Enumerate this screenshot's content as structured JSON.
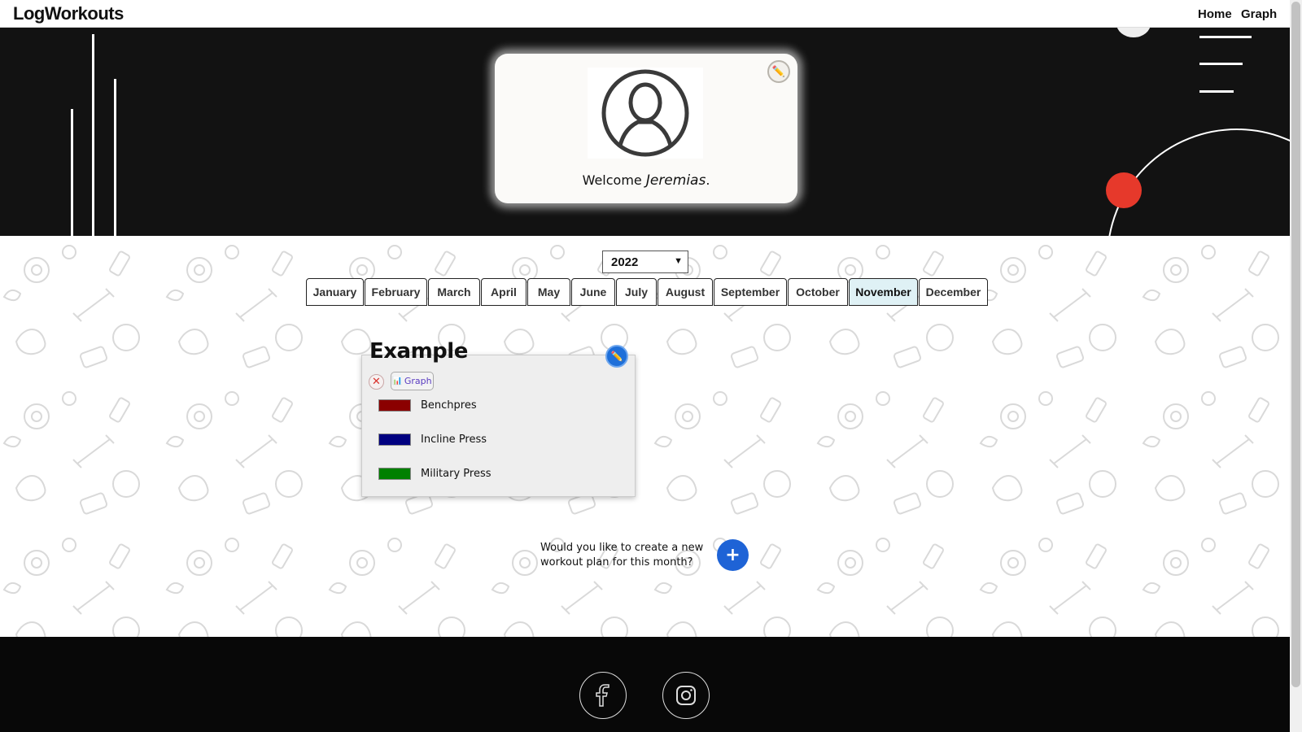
{
  "navbar": {
    "brand": "LogWorkouts",
    "links": [
      "Home",
      "Graph"
    ]
  },
  "profile": {
    "welcome_text": "Welcome",
    "username": "Jeremias",
    "username_suffix": ".",
    "avatar_icon": "user-silhouette-icon",
    "edit_icon": "pencil-icon"
  },
  "calendar": {
    "selected_year": "2022",
    "months": [
      "January",
      "February",
      "March",
      "April",
      "May",
      "June",
      "July",
      "August",
      "September",
      "October",
      "November",
      "December"
    ],
    "active_month": "November"
  },
  "plan": {
    "title": "Example",
    "graph_button_label": "Graph",
    "exercises": [
      {
        "name": "Benchpres",
        "color": "#8b0000"
      },
      {
        "name": "Incline Press",
        "color": "#000080"
      },
      {
        "name": "Military Press",
        "color": "#008000"
      }
    ]
  },
  "create_plan": {
    "prompt": "Would you like to create a new workout plan for this month?",
    "button_label": "+"
  },
  "footer": {
    "social": [
      "facebook-icon",
      "instagram-icon"
    ]
  },
  "colors": {
    "hero_bg": "#121212",
    "accent_red": "#e6392b",
    "accent_blue": "#1e63d6",
    "active_tab": "#dff1f5"
  }
}
